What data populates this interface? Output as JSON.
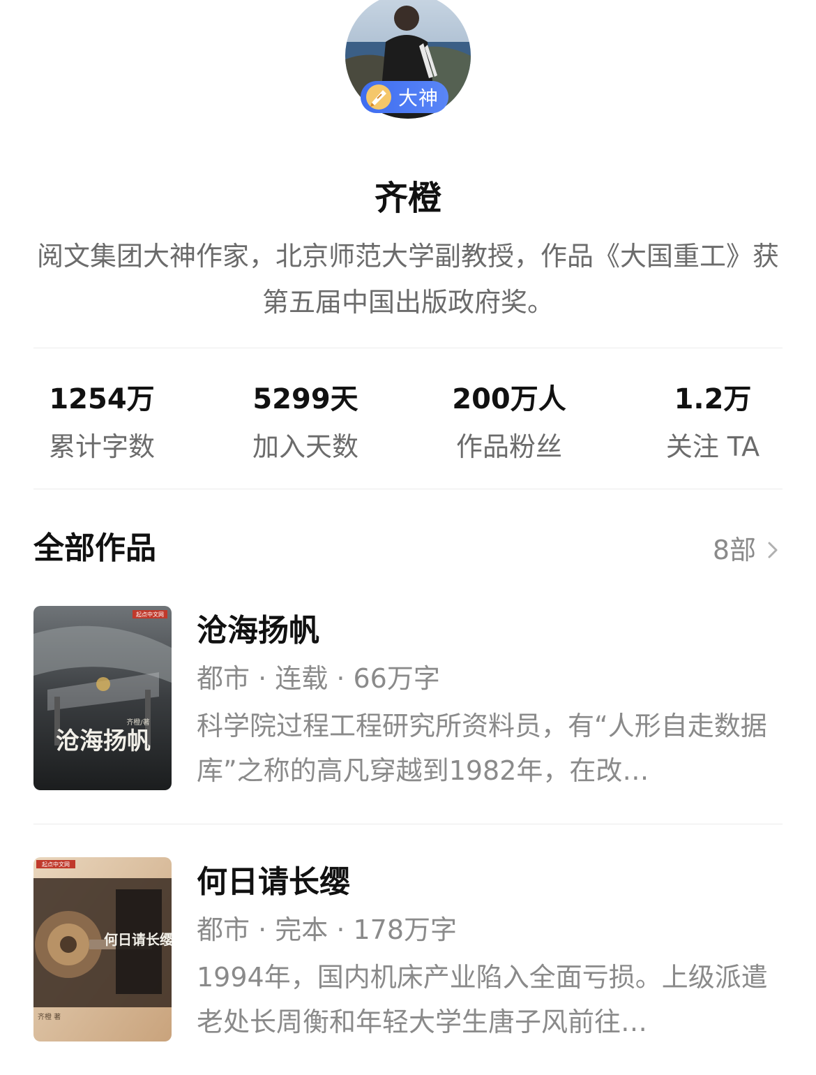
{
  "author": {
    "badge_label": "大神",
    "name": "齐橙",
    "bio": "阅文集团大神作家，北京师范大学副教授，作品《大国重工》获第五届中国出版政府奖。"
  },
  "stats": [
    {
      "value": "1254万",
      "label": "累计字数"
    },
    {
      "value": "5299天",
      "label": "加入天数"
    },
    {
      "value": "200万人",
      "label": "作品粉丝"
    },
    {
      "value": "1.2万",
      "label": "关注 TA"
    }
  ],
  "works_section": {
    "title": "全部作品",
    "count": "8部"
  },
  "books": [
    {
      "title": "沧海扬帆",
      "meta": "都市 · 连载 · 66万字",
      "description": "科学院过程工程研究所资料员，有“人形自走数据库”之称的高凡穿越到1982年，在改…",
      "cover_title": "沧海扬帆",
      "cover_author": "齐橙/著",
      "cover_publisher": "起点中文网"
    },
    {
      "title": "何日请长缨",
      "meta": "都市 · 完本 · 178万字",
      "description": "1994年，国内机床产业陷入全面亏损。上级派遣老处长周衡和年轻大学生唐子风前往…",
      "cover_title": "何日请长缨",
      "cover_author": "齐橙 著",
      "cover_publisher": "起点中文网"
    }
  ],
  "icons": {
    "badge": "quill-pen-icon",
    "more": "chevron-right-icon"
  },
  "colors": {
    "badge_blue": "#3e6df0",
    "text_primary": "#111111",
    "text_secondary": "#6b6b6b",
    "text_muted": "#8a8a8a",
    "divider": "#ebebeb"
  }
}
